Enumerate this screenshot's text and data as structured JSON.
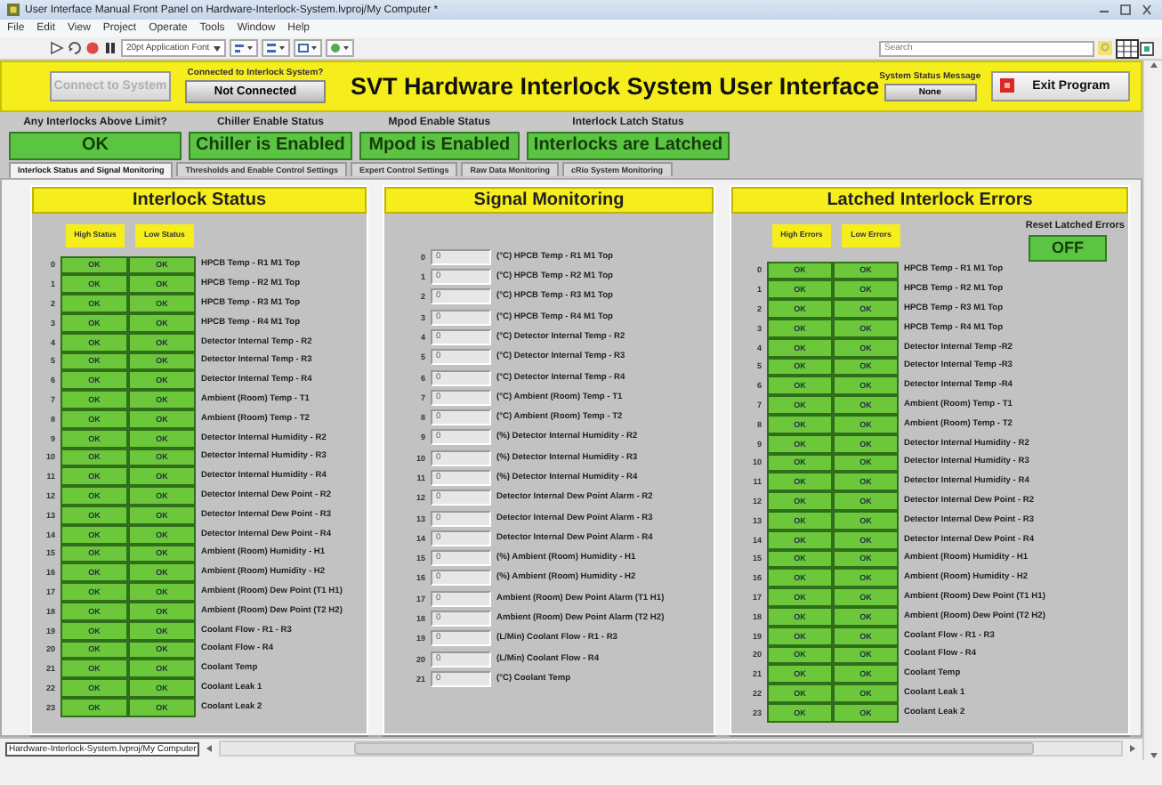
{
  "window": {
    "title": "User Interface Manual Front Panel on Hardware-Interlock-System.lvproj/My Computer *"
  },
  "menu": [
    "File",
    "Edit",
    "View",
    "Project",
    "Operate",
    "Tools",
    "Window",
    "Help"
  ],
  "toolbar": {
    "font_dropdown": "20pt Application Font",
    "search": {
      "placeholder": "Search"
    }
  },
  "header": {
    "connect_button": {
      "label": "Connect to System",
      "disabled": true
    },
    "connection": {
      "label": "Connected to Interlock System?",
      "value": "Not Connected"
    },
    "title": "SVT Hardware Interlock System User Interface",
    "status_message": {
      "label": "System Status Message",
      "value": "None"
    },
    "exit_button": "Exit Program"
  },
  "indicators": [
    {
      "label": "Any Interlocks Above Limit?",
      "value": "OK"
    },
    {
      "label": "Chiller Enable Status",
      "value": "Chiller is Enabled"
    },
    {
      "label": "Mpod Enable Status",
      "value": "Mpod is Enabled"
    },
    {
      "label": "Interlock Latch Status",
      "value": "Interlocks are Latched"
    }
  ],
  "tabs": [
    {
      "label": "Interlock Status and Signal Monitoring",
      "selected": true
    },
    {
      "label": "Thresholds and Enable Control Settings",
      "selected": false
    },
    {
      "label": "Expert Control Settings",
      "selected": false
    },
    {
      "label": "Raw Data Monitoring",
      "selected": false
    },
    {
      "label": "cRio System Monitoring",
      "selected": false
    }
  ],
  "interlock_status": {
    "title": "Interlock Status",
    "columns": [
      "High Status",
      "Low Status"
    ],
    "rows": [
      {
        "index": "0",
        "high": "OK",
        "low": "OK",
        "label": "HPCB Temp - R1 M1 Top"
      },
      {
        "index": "1",
        "high": "OK",
        "low": "OK",
        "label": "HPCB Temp - R2 M1 Top"
      },
      {
        "index": "2",
        "high": "OK",
        "low": "OK",
        "label": "HPCB Temp - R3 M1 Top"
      },
      {
        "index": "3",
        "high": "OK",
        "low": "OK",
        "label": "HPCB Temp - R4 M1 Top"
      },
      {
        "index": "4",
        "high": "OK",
        "low": "OK",
        "label": "Detector Internal Temp - R2"
      },
      {
        "index": "5",
        "high": "OK",
        "low": "OK",
        "label": "Detector Internal Temp - R3"
      },
      {
        "index": "6",
        "high": "OK",
        "low": "OK",
        "label": "Detector Internal Temp - R4"
      },
      {
        "index": "7",
        "high": "OK",
        "low": "OK",
        "label": "Ambient (Room) Temp - T1"
      },
      {
        "index": "8",
        "high": "OK",
        "low": "OK",
        "label": "Ambient (Room) Temp - T2"
      },
      {
        "index": "9",
        "high": "OK",
        "low": "OK",
        "label": "Detector Internal Humidity - R2"
      },
      {
        "index": "10",
        "high": "OK",
        "low": "OK",
        "label": "Detector Internal Humidity - R3"
      },
      {
        "index": "11",
        "high": "OK",
        "low": "OK",
        "label": "Detector Internal Humidity - R4"
      },
      {
        "index": "12",
        "high": "OK",
        "low": "OK",
        "label": "Detector Internal Dew Point - R2"
      },
      {
        "index": "13",
        "high": "OK",
        "low": "OK",
        "label": "Detector Internal Dew Point - R3"
      },
      {
        "index": "14",
        "high": "OK",
        "low": "OK",
        "label": "Detector Internal Dew Point - R4"
      },
      {
        "index": "15",
        "high": "OK",
        "low": "OK",
        "label": "Ambient (Room) Humidity - H1"
      },
      {
        "index": "16",
        "high": "OK",
        "low": "OK",
        "label": "Ambient (Room) Humidity - H2"
      },
      {
        "index": "17",
        "high": "OK",
        "low": "OK",
        "label": "Ambient (Room) Dew Point (T1 H1)"
      },
      {
        "index": "18",
        "high": "OK",
        "low": "OK",
        "label": "Ambient (Room) Dew Point (T2 H2)"
      },
      {
        "index": "19",
        "high": "OK",
        "low": "OK",
        "label": "Coolant Flow - R1 - R3"
      },
      {
        "index": "20",
        "high": "OK",
        "low": "OK",
        "label": "Coolant Flow - R4"
      },
      {
        "index": "21",
        "high": "OK",
        "low": "OK",
        "label": "Coolant Temp"
      },
      {
        "index": "22",
        "high": "OK",
        "low": "OK",
        "label": "Coolant Leak 1"
      },
      {
        "index": "23",
        "high": "OK",
        "low": "OK",
        "label": "Coolant Leak 2"
      }
    ]
  },
  "signal_monitoring": {
    "title": "Signal Monitoring",
    "rows": [
      {
        "index": "0",
        "value": "0",
        "label": "(°C) HPCB Temp - R1 M1 Top"
      },
      {
        "index": "1",
        "value": "0",
        "label": "(°C) HPCB Temp - R2 M1 Top"
      },
      {
        "index": "2",
        "value": "0",
        "label": "(°C) HPCB Temp - R3 M1 Top"
      },
      {
        "index": "3",
        "value": "0",
        "label": "(°C) HPCB Temp - R4 M1 Top"
      },
      {
        "index": "4",
        "value": "0",
        "label": "(°C) Detector Internal Temp - R2"
      },
      {
        "index": "5",
        "value": "0",
        "label": "(°C) Detector Internal Temp - R3"
      },
      {
        "index": "6",
        "value": "0",
        "label": "(°C) Detector Internal Temp - R4"
      },
      {
        "index": "7",
        "value": "0",
        "label": "(°C) Ambient (Room) Temp - T1"
      },
      {
        "index": "8",
        "value": "0",
        "label": "(°C) Ambient (Room) Temp - T2"
      },
      {
        "index": "9",
        "value": "0",
        "label": "(%) Detector Internal Humidity - R2"
      },
      {
        "index": "10",
        "value": "0",
        "label": "(%) Detector Internal Humidity - R3"
      },
      {
        "index": "11",
        "value": "0",
        "label": "(%) Detector Internal Humidity - R4"
      },
      {
        "index": "12",
        "value": "0",
        "label": "Detector Internal Dew Point Alarm - R2"
      },
      {
        "index": "13",
        "value": "0",
        "label": "Detector Internal Dew Point Alarm - R3"
      },
      {
        "index": "14",
        "value": "0",
        "label": "Detector Internal Dew Point Alarm - R4"
      },
      {
        "index": "15",
        "value": "0",
        "label": "(%) Ambient (Room) Humidity - H1"
      },
      {
        "index": "16",
        "value": "0",
        "label": "(%) Ambient (Room) Humidity - H2"
      },
      {
        "index": "17",
        "value": "0",
        "label": "Ambient (Room) Dew Point Alarm (T1 H1)"
      },
      {
        "index": "18",
        "value": "0",
        "label": "Ambient (Room) Dew Point Alarm (T2 H2)"
      },
      {
        "index": "19",
        "value": "0",
        "label": "(L/Min) Coolant Flow - R1 - R3"
      },
      {
        "index": "20",
        "value": "0",
        "label": "(L/Min) Coolant Flow - R4"
      },
      {
        "index": "21",
        "value": "0",
        "label": "(°C) Coolant Temp"
      }
    ]
  },
  "latched_errors": {
    "title": "Latched Interlock Errors",
    "columns": [
      "High Errors",
      "Low Errors"
    ],
    "reset": {
      "label": "Reset Latched Errors",
      "value": "OFF"
    },
    "rows": [
      {
        "index": "0",
        "high": "OK",
        "low": "OK",
        "label": "HPCB Temp - R1 M1 Top"
      },
      {
        "index": "1",
        "high": "OK",
        "low": "OK",
        "label": "HPCB Temp - R2 M1 Top"
      },
      {
        "index": "2",
        "high": "OK",
        "low": "OK",
        "label": "HPCB Temp - R3 M1 Top"
      },
      {
        "index": "3",
        "high": "OK",
        "low": "OK",
        "label": "HPCB Temp - R4 M1 Top"
      },
      {
        "index": "4",
        "high": "OK",
        "low": "OK",
        "label": "Detector Internal Temp -R2"
      },
      {
        "index": "5",
        "high": "OK",
        "low": "OK",
        "label": "Detector Internal Temp -R3"
      },
      {
        "index": "6",
        "high": "OK",
        "low": "OK",
        "label": "Detector Internal Temp -R4"
      },
      {
        "index": "7",
        "high": "OK",
        "low": "OK",
        "label": "Ambient (Room) Temp - T1"
      },
      {
        "index": "8",
        "high": "OK",
        "low": "OK",
        "label": "Ambient (Room) Temp - T2"
      },
      {
        "index": "9",
        "high": "OK",
        "low": "OK",
        "label": "Detector Internal Humidity - R2"
      },
      {
        "index": "10",
        "high": "OK",
        "low": "OK",
        "label": "Detector Internal Humidity - R3"
      },
      {
        "index": "11",
        "high": "OK",
        "low": "OK",
        "label": "Detector Internal Humidity - R4"
      },
      {
        "index": "12",
        "high": "OK",
        "low": "OK",
        "label": "Detector Internal Dew Point - R2"
      },
      {
        "index": "13",
        "high": "OK",
        "low": "OK",
        "label": "Detector Internal Dew Point - R3"
      },
      {
        "index": "14",
        "high": "OK",
        "low": "OK",
        "label": "Detector Internal Dew Point - R4"
      },
      {
        "index": "15",
        "high": "OK",
        "low": "OK",
        "label": "Ambient (Room) Humidity - H1"
      },
      {
        "index": "16",
        "high": "OK",
        "low": "OK",
        "label": "Ambient (Room) Humidity - H2"
      },
      {
        "index": "17",
        "high": "OK",
        "low": "OK",
        "label": "Ambient (Room) Dew Point (T1 H1)"
      },
      {
        "index": "18",
        "high": "OK",
        "low": "OK",
        "label": "Ambient (Room) Dew Point (T2 H2)"
      },
      {
        "index": "19",
        "high": "OK",
        "low": "OK",
        "label": "Coolant Flow - R1 - R3"
      },
      {
        "index": "20",
        "high": "OK",
        "low": "OK",
        "label": "Coolant Flow - R4"
      },
      {
        "index": "21",
        "high": "OK",
        "low": "OK",
        "label": "Coolant Temp"
      },
      {
        "index": "22",
        "high": "OK",
        "low": "OK",
        "label": "Coolant Leak 1"
      },
      {
        "index": "23",
        "high": "OK",
        "low": "OK",
        "label": "Coolant Leak 2"
      }
    ]
  },
  "status_bar": {
    "path": "Hardware-Interlock-System.lvproj/My Computer"
  }
}
